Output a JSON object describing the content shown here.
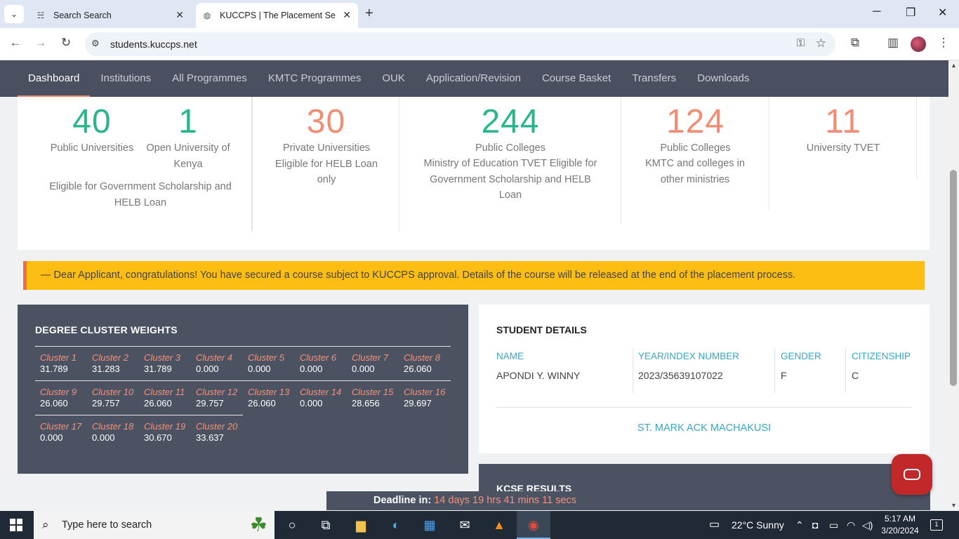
{
  "browser": {
    "tabs": [
      {
        "title": "Search Search",
        "favicon": "search-favicon"
      },
      {
        "title": "KUCCPS | The Placement Service",
        "favicon": "globe-icon"
      }
    ],
    "url": "students.kuccps.net"
  },
  "nav": {
    "items": [
      "Dashboard",
      "Institutions",
      "All Programmes",
      "KMTC Programmes",
      "OUK",
      "Application/Revision",
      "Course Basket",
      "Transfers",
      "Downloads"
    ],
    "active": "Dashboard"
  },
  "stats": {
    "public_universities": {
      "value": "40",
      "label": "Public Universities"
    },
    "open_university": {
      "value": "1",
      "label": "Open University of Kenya"
    },
    "gov_note": "Eligible for Government Scholarship and HELB Loan",
    "private_universities": {
      "value": "30",
      "label": "Private Universities Eligible for HELB Loan only"
    },
    "public_colleges_tvet": {
      "value": "244",
      "label": "Public Colleges",
      "sub": "Ministry of Education TVET Eligible for Government Scholarship and HELB Loan"
    },
    "public_colleges_kmtc": {
      "value": "124",
      "label": "Public Colleges",
      "sub": "KMTC and colleges in other ministries"
    },
    "university_tvet": {
      "value": "11",
      "label": "University TVET"
    }
  },
  "alert": {
    "text": "— Dear Applicant, congratulations! You have secured a course subject to KUCCPS approval. Details of the course will be released at the end of the placement process."
  },
  "cluster_weights": {
    "title": "DEGREE CLUSTER WEIGHTS",
    "rows": [
      [
        {
          "name": "Cluster 1",
          "value": "31.789"
        },
        {
          "name": "Cluster 2",
          "value": "31.283"
        },
        {
          "name": "Cluster 3",
          "value": "31.789"
        },
        {
          "name": "Cluster 4",
          "value": "0.000"
        },
        {
          "name": "Cluster 5",
          "value": "0.000"
        },
        {
          "name": "Cluster 6",
          "value": "0.000"
        },
        {
          "name": "Cluster 7",
          "value": "0.000"
        },
        {
          "name": "Cluster 8",
          "value": "26.060"
        }
      ],
      [
        {
          "name": "Cluster 9",
          "value": "26.060"
        },
        {
          "name": "Cluster 10",
          "value": "29.757"
        },
        {
          "name": "Cluster 11",
          "value": "26.060"
        },
        {
          "name": "Cluster 12",
          "value": "29.757"
        },
        {
          "name": "Cluster 13",
          "value": "26.060"
        },
        {
          "name": "Cluster 14",
          "value": "0.000"
        },
        {
          "name": "Cluster 15",
          "value": "28.656"
        },
        {
          "name": "Cluster 16",
          "value": "29.697"
        }
      ],
      [
        {
          "name": "Cluster 17",
          "value": "0.000"
        },
        {
          "name": "Cluster 18",
          "value": "0.000"
        },
        {
          "name": "Cluster 19",
          "value": "30.670"
        },
        {
          "name": "Cluster 20",
          "value": "33.637"
        }
      ]
    ]
  },
  "student": {
    "title": "STUDENT DETAILS",
    "headers": {
      "name": "NAME",
      "index": "YEAR/INDEX NUMBER",
      "gender": "GENDER",
      "citizenship": "CITIZENSHIP"
    },
    "values": {
      "name": "APONDI Y. WINNY",
      "index": "2023/35639107022",
      "gender": "F",
      "citizenship": "C"
    },
    "school": "ST. MARK ACK MACHAKUSI"
  },
  "kcse": {
    "title": "KCSE RESULTS"
  },
  "deadline": {
    "label": "Deadline in:",
    "value": "14 days 19 hrs 41 mins 11 secs"
  },
  "taskbar": {
    "search_placeholder": "Type here to search",
    "weather": "22°C  Sunny",
    "time": "5:17 AM",
    "date": "3/20/2024",
    "notification_count": "1"
  },
  "colors": {
    "nav_bg": "#4b5060",
    "green": "#2bb58e",
    "orange": "#f08d73",
    "alert": "#fdbd12",
    "link": "#37a8c2"
  }
}
